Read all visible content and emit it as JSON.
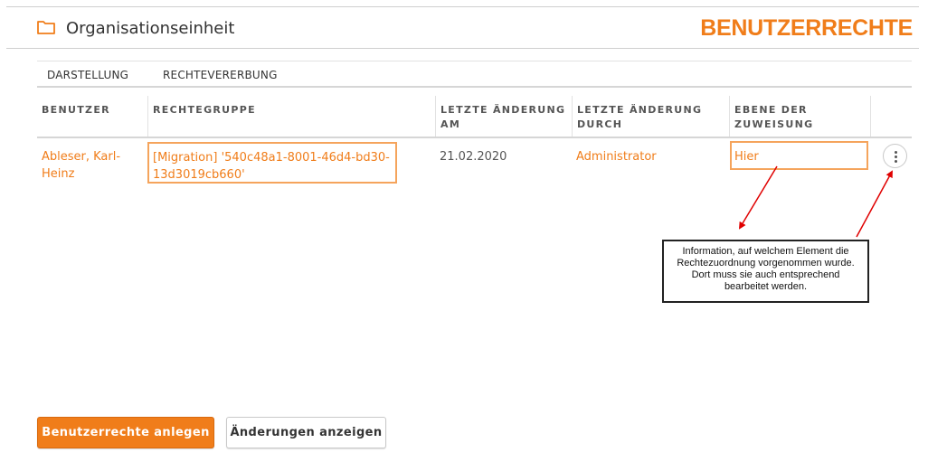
{
  "header": {
    "ou_title": "Organisationseinheit",
    "page_title": "BENUTZERRECHTE"
  },
  "tabs": [
    {
      "label": "DARSTELLUNG"
    },
    {
      "label": "RECHTEVERERBUNG"
    }
  ],
  "table": {
    "columns": [
      {
        "line1": "BENUTZER",
        "line2": ""
      },
      {
        "line1": "RECHTEGRUPPE",
        "line2": ""
      },
      {
        "line1": "LETZTE ÄNDERUNG",
        "line2": "AM"
      },
      {
        "line1": "LETZTE ÄNDERUNG",
        "line2": "DURCH"
      },
      {
        "line1": "EBENE DER",
        "line2": "ZUWEISUNG"
      },
      {
        "line1": "",
        "line2": ""
      }
    ],
    "rows": [
      {
        "user": "Ableser, Karl-Heinz",
        "group": "[Migration] '540c48a1-8001-46d4-bd30-13d3019cb660'",
        "date": "21.02.2020",
        "by": "Administrator",
        "level": "Hier"
      }
    ]
  },
  "callout": {
    "line1": "Information, auf welchem Element die",
    "line2": "Rechtezuordnung vorgenommen wurde.",
    "line3": "Dort muss sie auch entsprechend",
    "line4": "bearbeitet werden."
  },
  "actions": {
    "create_label": "Benutzerrechte anlegen",
    "changes_label": "Änderungen anzeigen"
  },
  "colors": {
    "accent": "#f07d1a",
    "highlight_border": "#f5a45c",
    "annotation_arrow": "#e00000"
  },
  "icons": {
    "folder": "folder-icon",
    "more": "more-vertical-icon"
  }
}
